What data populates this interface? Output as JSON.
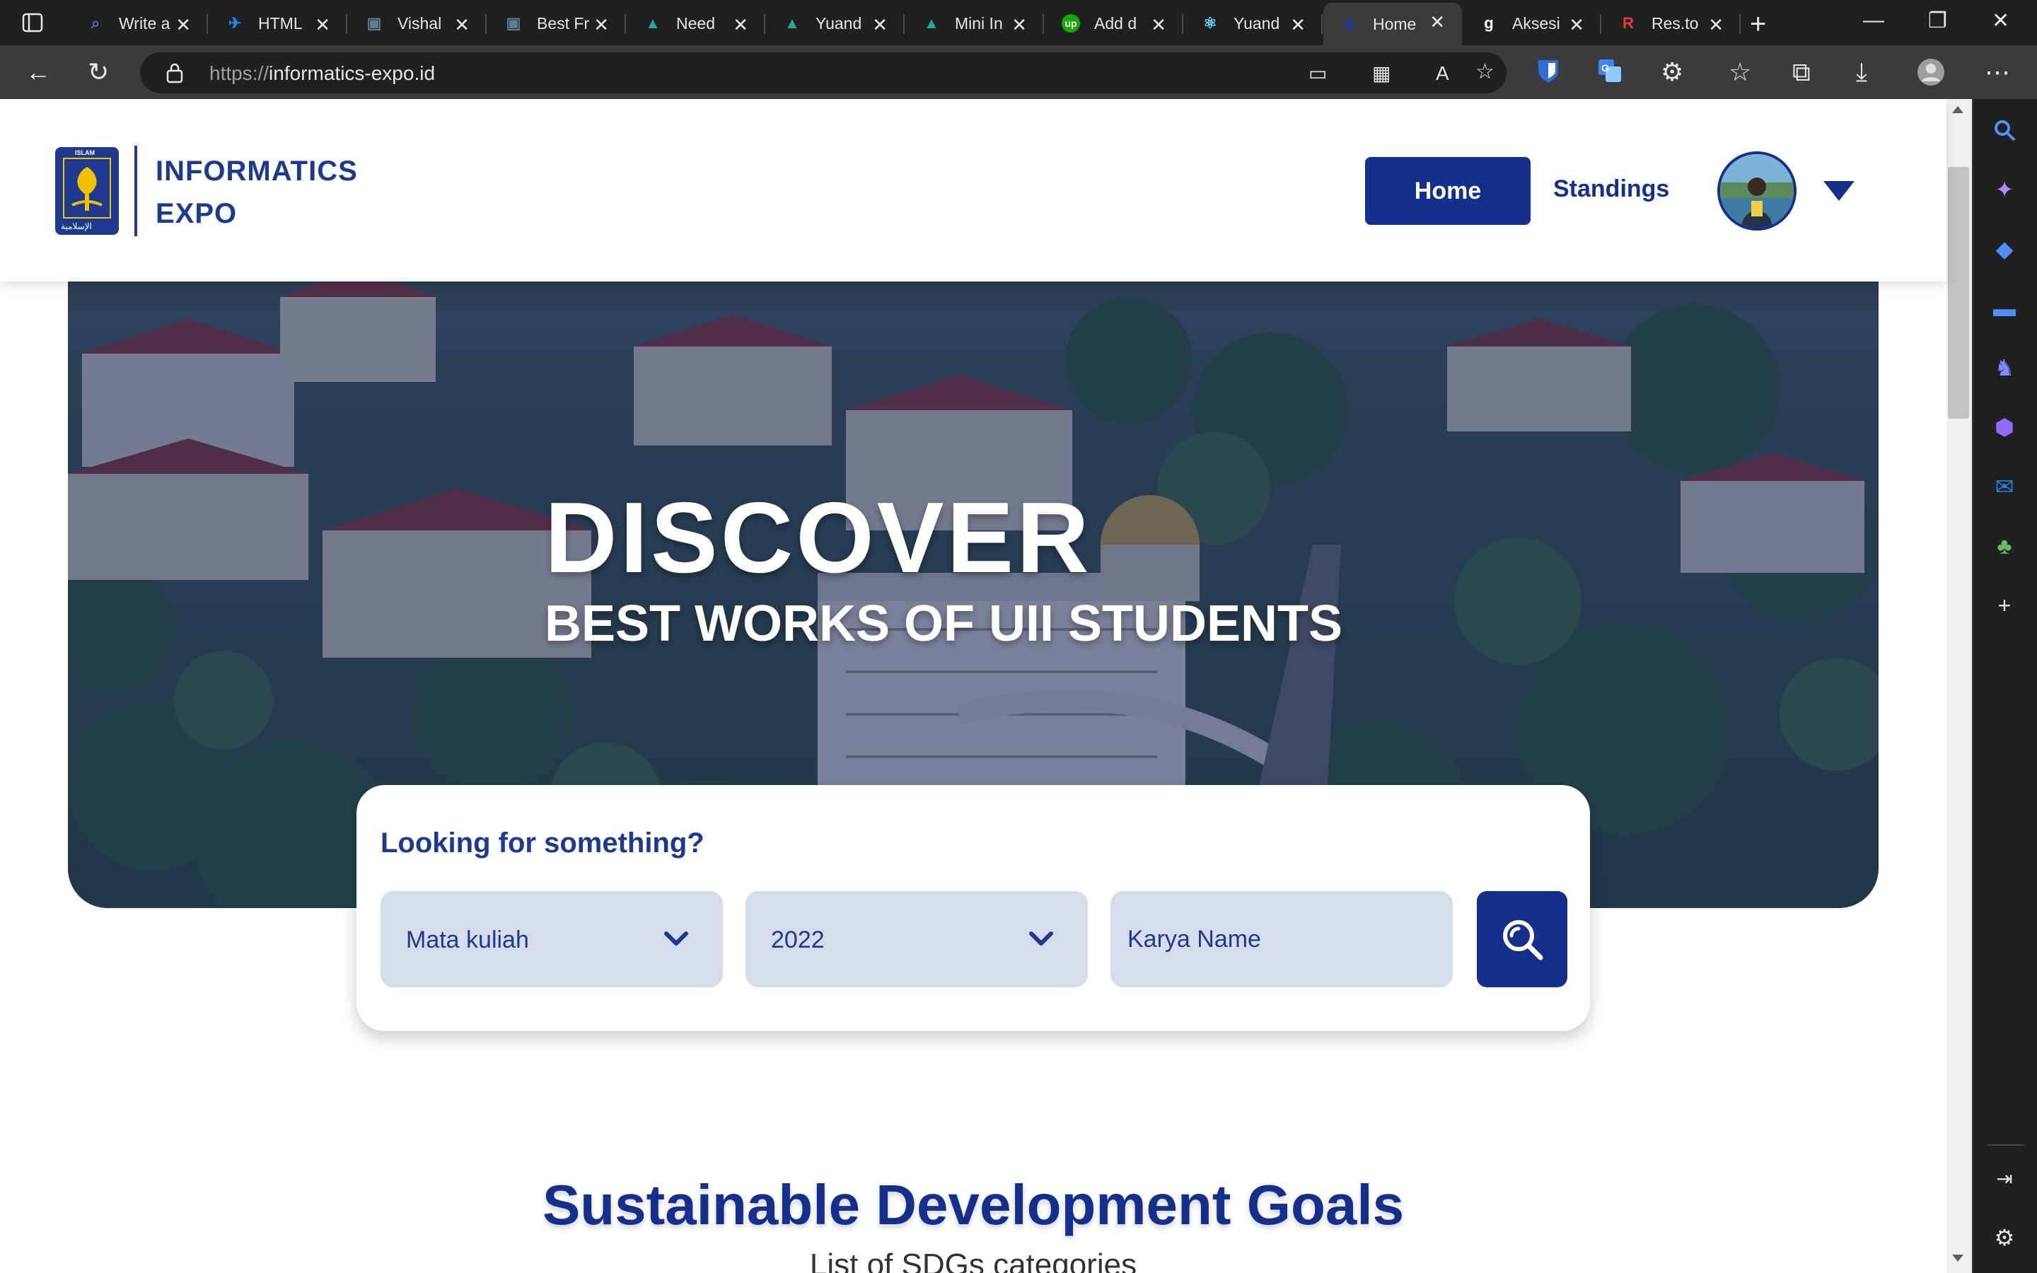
{
  "browser": {
    "tabs": [
      {
        "title": "Write a",
        "favicon": "search-icon",
        "fav_color": "#5c6bc0"
      },
      {
        "title": "HTML",
        "favicon": "bird-icon",
        "fav_color": "#1e88e5"
      },
      {
        "title": "Vishal",
        "favicon": "image-thumb-icon",
        "fav_color": "#607d8b"
      },
      {
        "title": "Best Fr",
        "favicon": "image-thumb-icon",
        "fav_color": "#607d8b"
      },
      {
        "title": "Need",
        "favicon": "mountain-icon",
        "fav_color": "#26a69a"
      },
      {
        "title": "Yuand",
        "favicon": "mountain-icon",
        "fav_color": "#26a69a"
      },
      {
        "title": "Mini In",
        "favicon": "mountain-icon",
        "fav_color": "#26a69a"
      },
      {
        "title": "Add d",
        "favicon": "upwork-icon",
        "fav_color": "#14a800"
      },
      {
        "title": "Yuand",
        "favicon": "react-icon",
        "fav_color": "#61dafb"
      },
      {
        "title": "Home",
        "favicon": "uii-icon",
        "fav_color": "#1d3a8f"
      },
      {
        "title": "Aksesi",
        "favicon": "g-icon",
        "fav_color": "#ffffff"
      },
      {
        "title": "Res.to",
        "favicon": "resto-icon",
        "fav_color": "#e53935"
      }
    ],
    "url_scheme": "https://",
    "url_host": "informatics-expo.id"
  },
  "site": {
    "brand_line1": "INFORMATICS",
    "brand_line2": "EXPO",
    "logo_text_top": "ISLAM",
    "logo_text_left": "UNIVERSITAS",
    "logo_text_right": "INDONESIA",
    "nav": {
      "home": "Home",
      "standings": "Standings"
    }
  },
  "hero": {
    "title": "DISCOVER",
    "subtitle": "BEST WORKS OF UII STUDENTS"
  },
  "search": {
    "heading": "Looking for something?",
    "course_select": "Mata kuliah",
    "year_select": "2022",
    "name_placeholder": "Karya Name"
  },
  "sdg": {
    "title": "Sustainable Development Goals",
    "subtitle": "List of SDGs categories"
  },
  "colors": {
    "brand": "#15308c",
    "field_bg": "#d6dcea",
    "hero_overlay": "#1a2a66"
  }
}
